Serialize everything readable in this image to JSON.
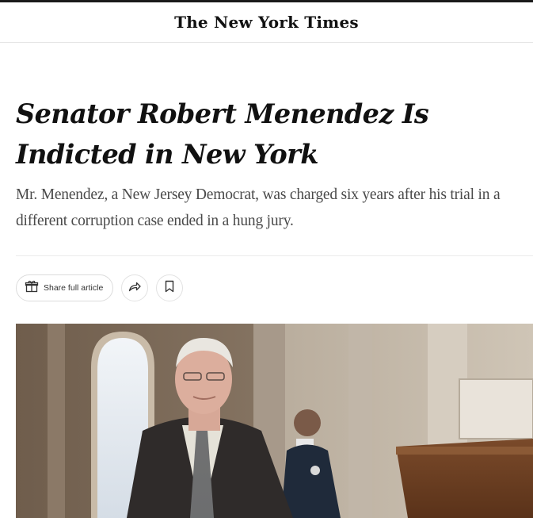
{
  "masthead": {
    "logo_text": "The New York Times"
  },
  "article": {
    "headline": "Senator Robert Menendez Is Indicted in New York",
    "summary": "Mr. Menendez, a New Jersey Democrat, was charged six years after his trial in a different corruption case ended in a hung jury."
  },
  "actions": {
    "share_full_article_label": "Share full article",
    "share_icon": "share-arrow-icon",
    "bookmark_icon": "bookmark-icon",
    "gift_icon": "gift-icon"
  },
  "colors": {
    "text": "#121212",
    "summary_text": "#4a4a4a",
    "divider": "#ebebeb"
  }
}
